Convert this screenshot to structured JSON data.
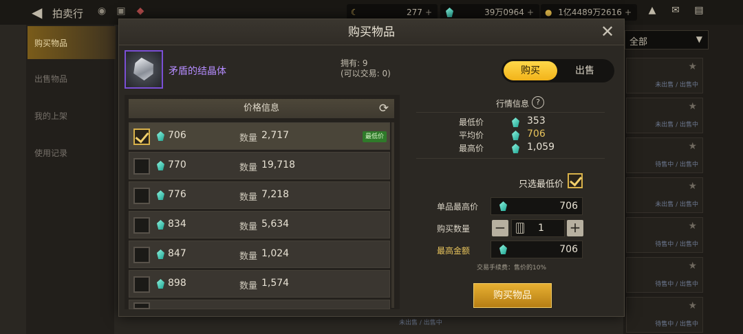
{
  "background": {
    "title": "拍卖行",
    "currencies": [
      {
        "value": "277",
        "color": "#bdb6a6"
      },
      {
        "value": "39万0964",
        "color": "#4fd3c0"
      },
      {
        "value": "1亿4489万2616",
        "color": "#e0b84a"
      }
    ],
    "sidebar": [
      "购买物品",
      "出售物品",
      "我的上架",
      "使用记录"
    ],
    "filter_label": "全部",
    "row_status": [
      "未出售 / 出售中",
      "未出售 / 出售中",
      "待售中 / 出售中",
      "未出售 / 出售中",
      "待售中 / 出售中",
      "待售中 / 出售中",
      "待售中 / 出售中"
    ],
    "bottom_status": "未出售 / 出售中"
  },
  "modal": {
    "title": "购买物品",
    "item": {
      "name": "矛盾的结晶体",
      "owned_line": "拥有: 9",
      "tradable_line": "(可以交易: 0)"
    },
    "toggle": {
      "buy": "购买",
      "sell": "出售",
      "active": "buy"
    },
    "price_list": {
      "header": "价格信息",
      "qty_label": "数量",
      "lowest_badge": "最低价",
      "rows": [
        {
          "price": "706",
          "qty": "2,717",
          "selected": true,
          "lowest": true
        },
        {
          "price": "770",
          "qty": "19,718",
          "selected": false,
          "lowest": false
        },
        {
          "price": "776",
          "qty": "7,218",
          "selected": false,
          "lowest": false
        },
        {
          "price": "834",
          "qty": "5,634",
          "selected": false,
          "lowest": false
        },
        {
          "price": "847",
          "qty": "1,024",
          "selected": false,
          "lowest": false
        },
        {
          "price": "898",
          "qty": "1,574",
          "selected": false,
          "lowest": false
        }
      ]
    },
    "market": {
      "title": "行情信息",
      "help": "?",
      "min_label": "最低价",
      "min_value": "353",
      "avg_label": "平均价",
      "avg_value": "706",
      "max_label": "最高价",
      "max_value": "1,059"
    },
    "form": {
      "only_lowest_label": "只选最低价",
      "only_lowest_checked": true,
      "unit_max_label": "单品最高价",
      "unit_max_value": "706",
      "qty_label": "购买数量",
      "qty_value": "1",
      "total_label": "最高金额",
      "total_value": "706",
      "fee_note": "交易手续费：售价的10%",
      "buy_button": "购买物品"
    }
  },
  "colors": {
    "accent_gold": "#f2b31a",
    "gem_teal": "#1fa593",
    "item_purple": "#b58cff",
    "lowest_green": "#2f7a2a"
  }
}
